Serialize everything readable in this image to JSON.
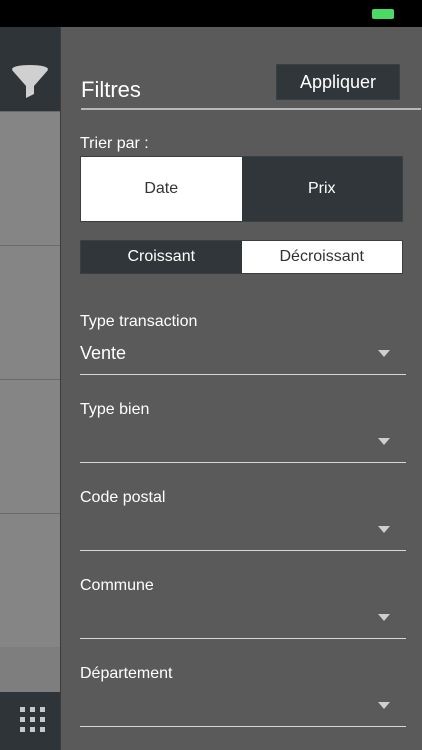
{
  "status": {
    "battery_color": "#4cd964"
  },
  "sidebar": {
    "filter_icon": "filter-icon",
    "grid_icon": "grid-icon"
  },
  "panel": {
    "title": "Filtres",
    "apply_label": "Appliquer"
  },
  "sort": {
    "label": "Trier par :",
    "field_options": [
      "Date",
      "Prix"
    ],
    "field_selected": "Date",
    "order_options": [
      "Croissant",
      "Décroissant"
    ],
    "order_selected": "Décroissant"
  },
  "fields": [
    {
      "label": "Type transaction",
      "value": "Vente"
    },
    {
      "label": "Type bien",
      "value": ""
    },
    {
      "label": "Code postal",
      "value": ""
    },
    {
      "label": "Commune",
      "value": ""
    },
    {
      "label": "Département",
      "value": ""
    }
  ]
}
